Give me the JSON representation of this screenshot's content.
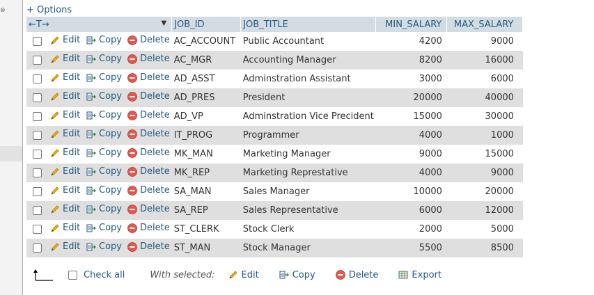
{
  "options_label": "+ Options",
  "header": {
    "col_arrows": "←T→",
    "columns": [
      "JOB_ID",
      "JOB_TITLE",
      "MIN_SALARY",
      "MAX_SALARY"
    ]
  },
  "actions": {
    "edit": "Edit",
    "copy": "Copy",
    "delete": "Delete"
  },
  "rows": [
    {
      "id": "AC_ACCOUNT",
      "title": "Public Accountant",
      "min": "4200",
      "max": "9000"
    },
    {
      "id": "AC_MGR",
      "title": "Accounting Manager",
      "min": "8200",
      "max": "16000"
    },
    {
      "id": "AD_ASST",
      "title": "Adminstration Assistant",
      "min": "3000",
      "max": "6000"
    },
    {
      "id": "AD_PRES",
      "title": "President",
      "min": "20000",
      "max": "40000"
    },
    {
      "id": "AD_VP",
      "title": "Adminstration Vice Precident",
      "min": "15000",
      "max": "30000"
    },
    {
      "id": "IT_PROG",
      "title": "Programmer",
      "min": "4000",
      "max": "1000"
    },
    {
      "id": "MK_MAN",
      "title": "Marketing Manager",
      "min": "9000",
      "max": "15000"
    },
    {
      "id": "MK_REP",
      "title": "Marketing Represtative",
      "min": "4000",
      "max": "9000"
    },
    {
      "id": "SA_MAN",
      "title": "Sales Manager",
      "min": "10000",
      "max": "20000"
    },
    {
      "id": "SA_REP",
      "title": "Sales Representative",
      "min": "6000",
      "max": "12000"
    },
    {
      "id": "ST_CLERK",
      "title": "Stock Clerk",
      "min": "2000",
      "max": "5000"
    },
    {
      "id": "ST_MAN",
      "title": "Stock Manager",
      "min": "5500",
      "max": "8500"
    }
  ],
  "footer": {
    "check_all": "Check all",
    "with_selected": "With selected:",
    "edit": "Edit",
    "copy": "Copy",
    "delete": "Delete",
    "export": "Export"
  },
  "colors": {
    "link": "#235a81",
    "header_bg": "#d3dce3",
    "row_alt": "#dfdfdf"
  }
}
